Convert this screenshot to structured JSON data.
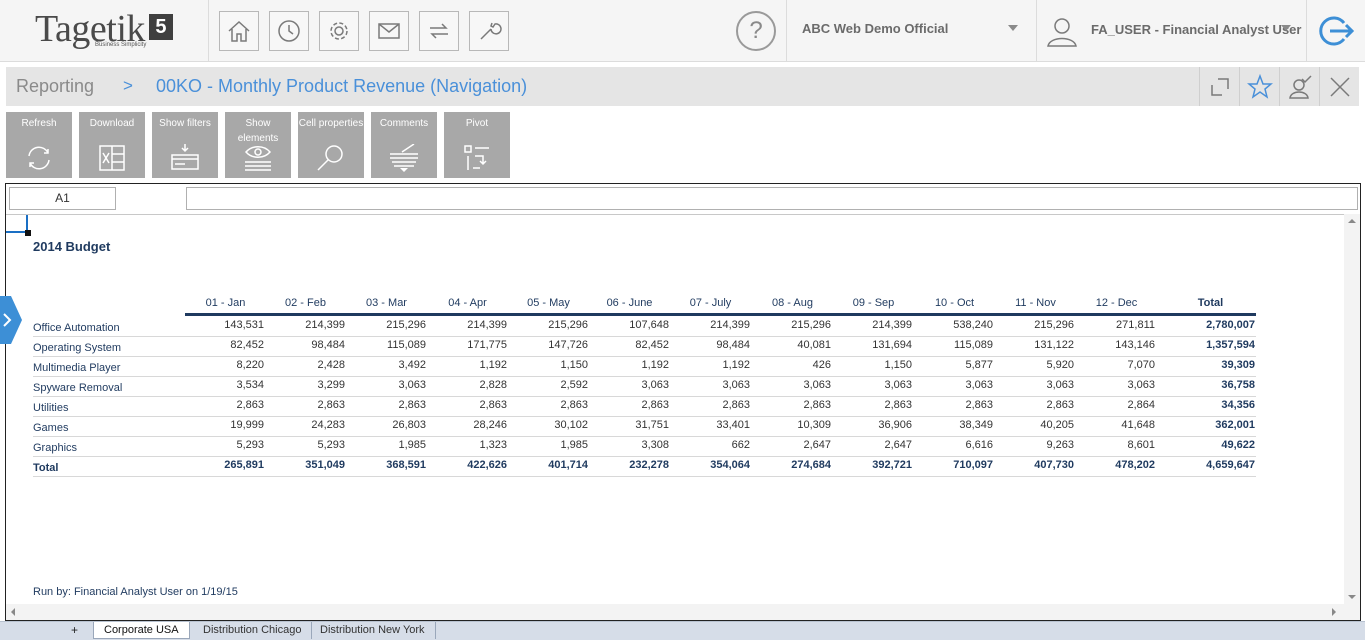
{
  "header": {
    "logo_text": "Tagetik",
    "logo_version": "5",
    "logo_tagline": "Business Simplicity",
    "nav_buttons": [
      "home-icon",
      "clock-icon",
      "gear-icon",
      "mail-icon",
      "transfer-icon",
      "wrench-icon"
    ],
    "help_label": "?",
    "company": "ABC Web Demo Official",
    "user": "FA_USER - Financial Analyst User"
  },
  "breadcrumb": {
    "root": "Reporting",
    "separator": ">",
    "title": "00KO - Monthly Product Revenue (Navigation)"
  },
  "toolbar": {
    "refresh": "Refresh",
    "download": "Download",
    "show_filters": "Show filters",
    "show_elements": "Show elements",
    "cell_properties": "Cell properties",
    "comments": "Comments",
    "pivot": "Pivot"
  },
  "sheet": {
    "cell_ref": "A1",
    "formula": "",
    "report_title": "2014 Budget",
    "run_by": "Run by: Financial Analyst User on 1/19/15",
    "columns": [
      "01 - Jan",
      "02 - Feb",
      "03 - Mar",
      "04 - Apr",
      "05 - May",
      "06 - June",
      "07 - July",
      "08 - Aug",
      "09 - Sep",
      "10 - Oct",
      "11 - Nov",
      "12 - Dec",
      "Total"
    ],
    "rows": [
      {
        "label": "Office Automation",
        "values": [
          "143,531",
          "214,399",
          "215,296",
          "214,399",
          "215,296",
          "107,648",
          "214,399",
          "215,296",
          "214,399",
          "538,240",
          "215,296",
          "271,811",
          "2,780,007"
        ]
      },
      {
        "label": "Operating System",
        "values": [
          "82,452",
          "98,484",
          "115,089",
          "171,775",
          "147,726",
          "82,452",
          "98,484",
          "40,081",
          "131,694",
          "115,089",
          "131,122",
          "143,146",
          "1,357,594"
        ]
      },
      {
        "label": "Multimedia Player",
        "values": [
          "8,220",
          "2,428",
          "3,492",
          "1,192",
          "1,150",
          "1,192",
          "1,192",
          "426",
          "1,150",
          "5,877",
          "5,920",
          "7,070",
          "39,309"
        ]
      },
      {
        "label": "Spyware Removal",
        "values": [
          "3,534",
          "3,299",
          "3,063",
          "2,828",
          "2,592",
          "3,063",
          "3,063",
          "3,063",
          "3,063",
          "3,063",
          "3,063",
          "3,063",
          "36,758"
        ]
      },
      {
        "label": "Utilities",
        "values": [
          "2,863",
          "2,863",
          "2,863",
          "2,863",
          "2,863",
          "2,863",
          "2,863",
          "2,863",
          "2,863",
          "2,863",
          "2,863",
          "2,864",
          "34,356"
        ]
      },
      {
        "label": "Games",
        "values": [
          "19,999",
          "24,283",
          "26,803",
          "28,246",
          "30,102",
          "31,751",
          "33,401",
          "10,309",
          "36,906",
          "38,349",
          "40,205",
          "41,648",
          "362,001"
        ]
      },
      {
        "label": "Graphics",
        "values": [
          "5,293",
          "5,293",
          "1,985",
          "1,323",
          "1,985",
          "3,308",
          "662",
          "2,647",
          "2,647",
          "6,616",
          "9,263",
          "8,601",
          "49,622"
        ]
      }
    ],
    "total_row": {
      "label": "Total",
      "values": [
        "265,891",
        "351,049",
        "368,591",
        "422,626",
        "401,714",
        "232,278",
        "354,064",
        "274,684",
        "392,721",
        "710,097",
        "407,730",
        "478,202",
        "4,659,647"
      ]
    }
  },
  "tabs": {
    "add": "+",
    "items": [
      "Corporate USA",
      "Distribution Chicago",
      "Distribution New York"
    ],
    "active": "Corporate USA"
  },
  "colors": {
    "accent_blue": "#4a90d9",
    "table_navy": "#1f3a5f",
    "toolbar_gray": "#a8a8a8"
  }
}
